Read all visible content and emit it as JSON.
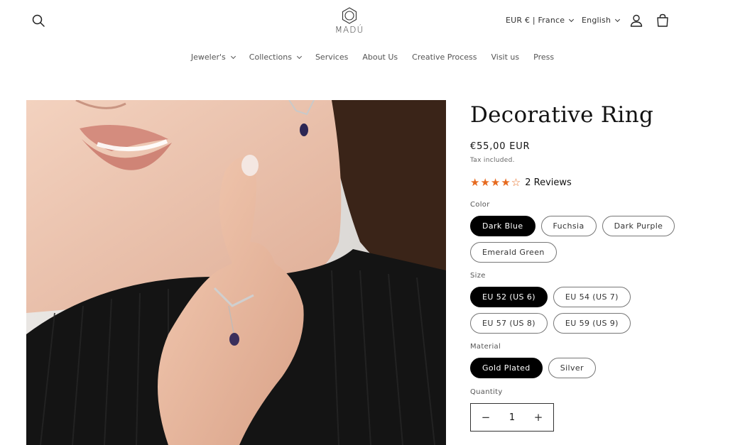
{
  "header": {
    "logo_text": "MADÚ",
    "currency": "EUR € | France",
    "language": "English"
  },
  "nav": {
    "items": [
      {
        "label": "Jeweler's",
        "has_dropdown": true
      },
      {
        "label": "Collections",
        "has_dropdown": true
      },
      {
        "label": "Services",
        "has_dropdown": false
      },
      {
        "label": "About Us",
        "has_dropdown": false
      },
      {
        "label": "Creative Process",
        "has_dropdown": false
      },
      {
        "label": "Visit us",
        "has_dropdown": false
      },
      {
        "label": "Press",
        "has_dropdown": false
      }
    ]
  },
  "product": {
    "title": "Decorative Ring",
    "price": "€55,00 EUR",
    "tax_note": "Tax included.",
    "rating": {
      "stars": 4,
      "max": 5,
      "reviews_label": "2 Reviews",
      "star_color": "#e66a1f"
    },
    "color": {
      "label": "Color",
      "options": [
        "Dark Blue",
        "Fuchsia",
        "Dark Purple",
        "Emerald Green"
      ],
      "selected": "Dark Blue"
    },
    "size": {
      "label": "Size",
      "options": [
        "EU 52 (US 6)",
        "EU 54 (US 7)",
        "EU 57 (US 8)",
        "EU 59 (US 9)"
      ],
      "selected": "EU 52 (US 6)"
    },
    "material": {
      "label": "Material",
      "options": [
        "Gold Plated",
        "Silver"
      ],
      "selected": "Gold Plated"
    },
    "quantity": {
      "label": "Quantity",
      "value": "1",
      "minus": "−",
      "plus": "+"
    }
  },
  "icons": {
    "search": "search-icon",
    "account": "account-icon",
    "cart": "cart-icon"
  }
}
